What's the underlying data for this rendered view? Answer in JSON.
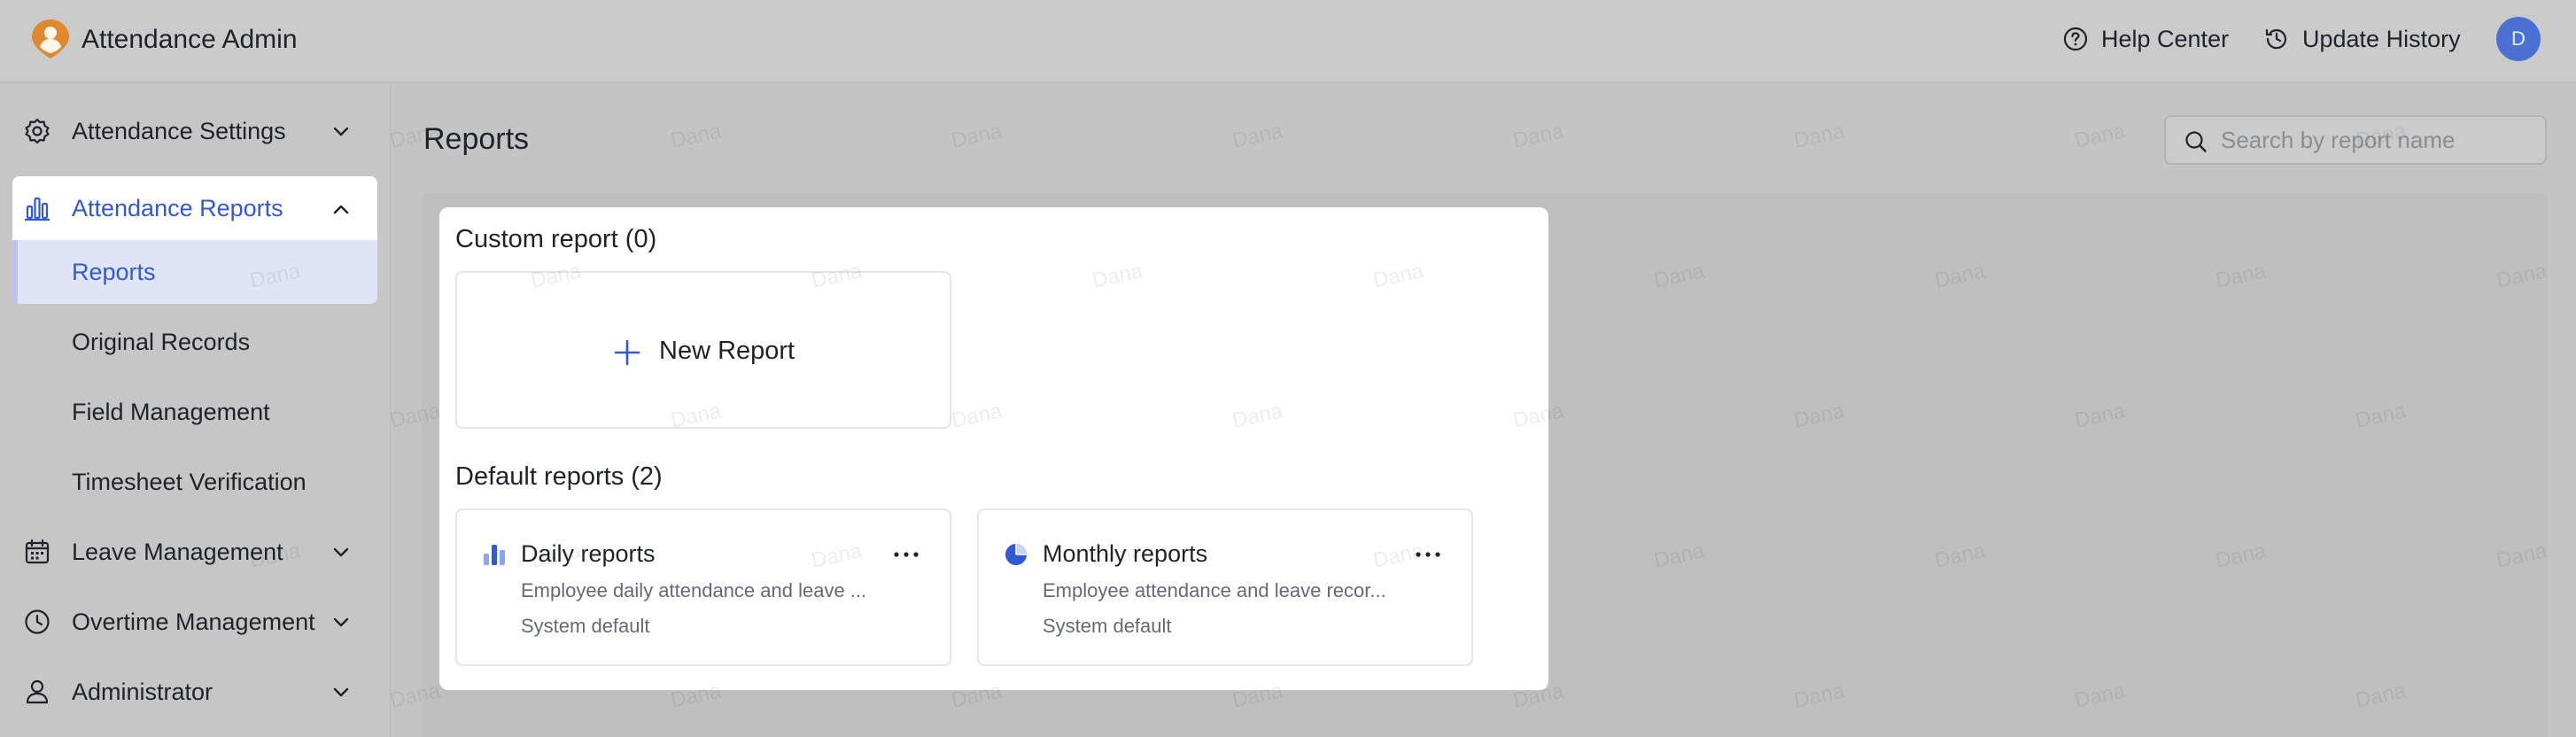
{
  "app": {
    "title": "Attendance Admin",
    "accent_color": "#3358d4",
    "logo_color": "#e0892f"
  },
  "header": {
    "help_label": "Help Center",
    "history_label": "Update History",
    "avatar_initial": "D"
  },
  "sidebar": {
    "settings_label": "Attendance Settings",
    "reports_label": "Attendance Reports",
    "sub_items": [
      "Reports",
      "Original Records",
      "Field Management",
      "Timesheet Verification"
    ],
    "leave_label": "Leave Management",
    "overtime_label": "Overtime Management",
    "admin_label": "Administrator"
  },
  "main": {
    "page_title": "Reports",
    "search_placeholder": "Search by report name",
    "custom_section_title": "Custom report (0)",
    "new_report_label": "New Report",
    "default_section_title": "Default reports (2)",
    "default_reports": [
      {
        "title": "Daily reports",
        "description": "Employee daily attendance and leave ...",
        "tag": "System default",
        "icon": "bar-chart-icon"
      },
      {
        "title": "Monthly reports",
        "description": "Employee attendance and leave recor...",
        "tag": "System default",
        "icon": "pie-chart-icon"
      }
    ]
  },
  "watermark_text": "Dana"
}
